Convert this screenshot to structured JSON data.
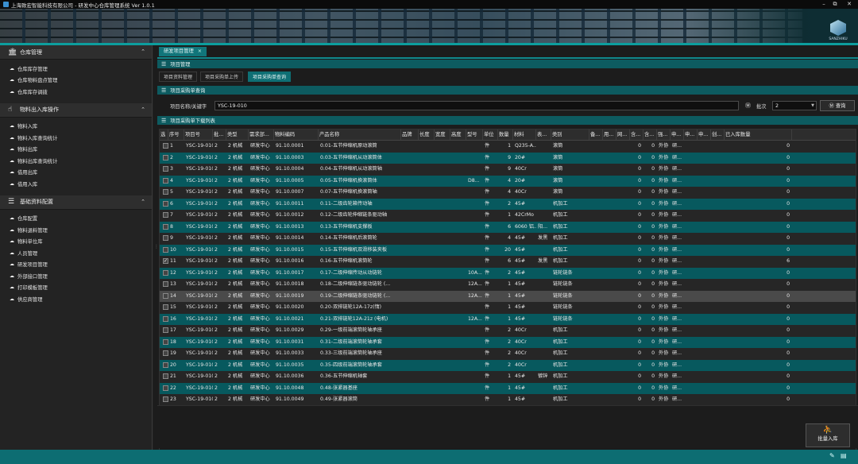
{
  "window": {
    "title": "上海致宏智能科技有限公司 - 研发中心仓库管理系统 Ver 1.0.1",
    "minimize": "–",
    "maximize": "⧉",
    "close": "✕"
  },
  "banner": {
    "logo_text": "SANZHIKU"
  },
  "sidebar": {
    "groups": [
      {
        "label": "仓库管理",
        "icon": "warehouse-icon",
        "items": [
          "仓库库存管理",
          "仓库物料盘点管理",
          "仓库库存调拨"
        ]
      },
      {
        "label": "物料出入库操作",
        "icon": "hand-pointer-icon",
        "items": [
          "物料入库",
          "物料入库查询统计",
          "物料出库",
          "物料出库查询统计",
          "借用出库",
          "借用入库"
        ]
      },
      {
        "label": "基础资料配置",
        "icon": "list-icon",
        "items": [
          "仓库配置",
          "物料退料管理",
          "物料单位库",
          "人员管理",
          "研发项目管理",
          "外部接口管理",
          "打印模板管理",
          "供应商管理"
        ]
      }
    ]
  },
  "main": {
    "top_tab": "研发项目管理",
    "section_project": "项目管理",
    "subtabs": [
      "项目资料管理",
      "项目采购单上传",
      "项目采购单查询"
    ],
    "active_subtab": 2,
    "section_query": "项目采购单查询",
    "query": {
      "label": "项目名称/关键字",
      "value": "YSC-19-010",
      "batch_label": "批次",
      "batch_value": "2",
      "button": "查询"
    },
    "section_detail": "项目采购单下载列表",
    "columns": [
      "选",
      "序号",
      "项目号",
      "批...",
      "类型",
      "需求部...",
      "物料编码",
      "产品名称",
      "品牌",
      "长度",
      "宽度",
      "高度",
      "型号",
      "单位",
      "数量",
      "材料",
      "表...",
      "类别",
      "备...",
      "用...",
      "网...",
      "含...",
      "含...",
      "强...",
      "申...",
      "申...",
      "申...",
      "创...",
      "已入库数量"
    ],
    "rows": [
      {
        "no": "1",
        "proj": "YSC-19-010",
        "batch": "2",
        "type": "2 机械",
        "dept": "研发中心",
        "code": "91.10.0001",
        "name": "0.01-五节伸缩机原动滚筒",
        "model": "",
        "unit": "件",
        "qty": "1",
        "mat": "Q235-A...",
        "surf": "",
        "cat": "滚筒",
        "c1": "0",
        "c2": "0",
        "sa": "外协",
        "sb": "研...",
        "stock": "0",
        "checked": false
      },
      {
        "no": "2",
        "proj": "YSC-19-010",
        "batch": "2",
        "type": "2 机械",
        "dept": "研发中心",
        "code": "91.10.0003",
        "name": "0.03-五节伸缩机从动滚筒体",
        "model": "",
        "unit": "件",
        "qty": "9",
        "mat": "20#",
        "surf": "",
        "cat": "滚筒",
        "c1": "0",
        "c2": "0",
        "sa": "外协",
        "sb": "研...",
        "stock": "0",
        "checked": false
      },
      {
        "no": "3",
        "proj": "YSC-19-010",
        "batch": "2",
        "type": "2 机械",
        "dept": "研发中心",
        "code": "91.10.0004",
        "name": "0.04-五节伸缩机从动滚筒轴",
        "model": "",
        "unit": "件",
        "qty": "9",
        "mat": "40Cr",
        "surf": "",
        "cat": "滚筒",
        "c1": "0",
        "c2": "0",
        "sa": "外协",
        "sb": "研...",
        "stock": "0",
        "checked": false
      },
      {
        "no": "4",
        "proj": "YSC-19-010",
        "batch": "2",
        "type": "2 机械",
        "dept": "研发中心",
        "code": "91.10.0005",
        "name": "0.05-五节伸缩机换滚筒体",
        "model": "D8...",
        "unit": "件",
        "qty": "4",
        "mat": "20#",
        "surf": "",
        "cat": "滚筒",
        "c1": "0",
        "c2": "0",
        "sa": "外协",
        "sb": "研...",
        "stock": "0",
        "checked": false
      },
      {
        "no": "5",
        "proj": "YSC-19-010",
        "batch": "2",
        "type": "2 机械",
        "dept": "研发中心",
        "code": "91.10.0007",
        "name": "0.07-五节伸缩机换滚筒轴",
        "model": "",
        "unit": "件",
        "qty": "4",
        "mat": "40Cr",
        "surf": "",
        "cat": "滚筒",
        "c1": "0",
        "c2": "0",
        "sa": "外协",
        "sb": "研...",
        "stock": "0",
        "checked": false
      },
      {
        "no": "6",
        "proj": "YSC-19-010",
        "batch": "2",
        "type": "2 机械",
        "dept": "研发中心",
        "code": "91.10.0011",
        "name": "0.11-二级齿轮箱传动轴",
        "model": "",
        "unit": "件",
        "qty": "2",
        "mat": "45#",
        "surf": "",
        "cat": "机加工",
        "c1": "0",
        "c2": "0",
        "sa": "外协",
        "sb": "研...",
        "stock": "0",
        "checked": false
      },
      {
        "no": "7",
        "proj": "YSC-19-010",
        "batch": "2",
        "type": "2 机械",
        "dept": "研发中心",
        "code": "91.10.0012",
        "name": "0.12-二级齿轮伸缩链条驱动轴",
        "model": "",
        "unit": "件",
        "qty": "1",
        "mat": "42CrMo",
        "surf": "",
        "cat": "机加工",
        "c1": "0",
        "c2": "0",
        "sa": "外协",
        "sb": "研...",
        "stock": "0",
        "checked": false
      },
      {
        "no": "8",
        "proj": "YSC-19-010",
        "batch": "2",
        "type": "2 机械",
        "dept": "研发中心",
        "code": "91.10.0013",
        "name": "0.13-五节伸缩机支撑板",
        "model": "",
        "unit": "件",
        "qty": "6",
        "mat": "6060 铝...",
        "surf": "阳...",
        "cat": "机加工",
        "c1": "0",
        "c2": "0",
        "sa": "外协",
        "sb": "研...",
        "stock": "0",
        "checked": false
      },
      {
        "no": "9",
        "proj": "YSC-19-010",
        "batch": "2",
        "type": "2 机械",
        "dept": "研发中心",
        "code": "91.10.0014",
        "name": "0.14-五节伸缩机后滚筒轮",
        "model": "",
        "unit": "件",
        "qty": "4",
        "mat": "45#",
        "surf": "发黑",
        "cat": "机加工",
        "c1": "0",
        "c2": "0",
        "sa": "外协",
        "sb": "研...",
        "stock": "0",
        "checked": false
      },
      {
        "no": "10",
        "proj": "YSC-19-010",
        "batch": "2",
        "type": "2 机械",
        "dept": "研发中心",
        "code": "91.10.0015",
        "name": "0.15-五节伸缩机双滑移装夹板",
        "model": "",
        "unit": "件",
        "qty": "20",
        "mat": "45#",
        "surf": "",
        "cat": "机加工",
        "c1": "0",
        "c2": "0",
        "sa": "外协",
        "sb": "研...",
        "stock": "0",
        "checked": false
      },
      {
        "no": "11",
        "proj": "YSC-19-010",
        "batch": "2",
        "type": "2 机械",
        "dept": "研发中心",
        "code": "91.10.0016",
        "name": "0.16-五节伸缩机滚筒轮",
        "model": "",
        "unit": "件",
        "qty": "6",
        "mat": "45#",
        "surf": "发黑",
        "cat": "机加工",
        "c1": "0",
        "c2": "0",
        "sa": "外协",
        "sb": "研...",
        "stock": "6",
        "checked": true
      },
      {
        "no": "12",
        "proj": "YSC-19-010",
        "batch": "2",
        "type": "2 机械",
        "dept": "研发中心",
        "code": "91.10.0017",
        "name": "0.17-二级伸缩传动从动链轮",
        "model": "10A...",
        "unit": "件",
        "qty": "2",
        "mat": "45#",
        "surf": "",
        "cat": "链轮链条",
        "c1": "0",
        "c2": "0",
        "sa": "外协",
        "sb": "研...",
        "stock": "0",
        "checked": false
      },
      {
        "no": "13",
        "proj": "YSC-19-010",
        "batch": "2",
        "type": "2 机械",
        "dept": "研发中心",
        "code": "91.10.0018",
        "name": "0.18-二级伸缩链条驱动链轮 (...",
        "model": "12A...",
        "unit": "件",
        "qty": "1",
        "mat": "45#",
        "surf": "",
        "cat": "链轮链条",
        "c1": "0",
        "c2": "0",
        "sa": "外协",
        "sb": "研...",
        "stock": "0",
        "checked": false
      },
      {
        "no": "14",
        "proj": "YSC-19-010",
        "batch": "2",
        "type": "2 机械",
        "dept": "研发中心",
        "code": "91.10.0019",
        "name": "0.19-二级伸缩链条驱动链轮 (...",
        "model": "12A...",
        "unit": "件",
        "qty": "1",
        "mat": "45#",
        "surf": "",
        "cat": "链轮链条",
        "c1": "0",
        "c2": "0",
        "sa": "外协",
        "sb": "研...",
        "stock": "0",
        "checked": false
      },
      {
        "no": "15",
        "proj": "YSC-19-010",
        "batch": "2",
        "type": "2 机械",
        "dept": "研发中心",
        "code": "91.10.0020",
        "name": "0.20-双排链轮12A-17z(惰)",
        "model": "",
        "unit": "件",
        "qty": "1",
        "mat": "45#",
        "surf": "",
        "cat": "链轮链条",
        "c1": "0",
        "c2": "0",
        "sa": "外协",
        "sb": "研...",
        "stock": "0",
        "checked": false
      },
      {
        "no": "16",
        "proj": "YSC-19-010",
        "batch": "2",
        "type": "2 机械",
        "dept": "研发中心",
        "code": "91.10.0021",
        "name": "0.21-双排链轮12A-21z (电机)",
        "model": "12A...",
        "unit": "件",
        "qty": "1",
        "mat": "45#",
        "surf": "",
        "cat": "链轮链条",
        "c1": "0",
        "c2": "0",
        "sa": "外协",
        "sb": "研...",
        "stock": "0",
        "checked": false
      },
      {
        "no": "17",
        "proj": "YSC-19-010",
        "batch": "2",
        "type": "2 机械",
        "dept": "研发中心",
        "code": "91.10.0029",
        "name": "0.29-一级前端滚筒轮轴承座",
        "model": "",
        "unit": "件",
        "qty": "2",
        "mat": "40Cr",
        "surf": "",
        "cat": "机加工",
        "c1": "0",
        "c2": "0",
        "sa": "外协",
        "sb": "研...",
        "stock": "0",
        "checked": false
      },
      {
        "no": "18",
        "proj": "YSC-19-010",
        "batch": "2",
        "type": "2 机械",
        "dept": "研发中心",
        "code": "91.10.0031",
        "name": "0.31-二级前端滚筒轮轴承套",
        "model": "",
        "unit": "件",
        "qty": "2",
        "mat": "40Cr",
        "surf": "",
        "cat": "机加工",
        "c1": "0",
        "c2": "0",
        "sa": "外协",
        "sb": "研...",
        "stock": "0",
        "checked": false
      },
      {
        "no": "19",
        "proj": "YSC-19-010",
        "batch": "2",
        "type": "2 机械",
        "dept": "研发中心",
        "code": "91.10.0033",
        "name": "0.33-三级前端滚筒轮轴承座",
        "model": "",
        "unit": "件",
        "qty": "2",
        "mat": "40Cr",
        "surf": "",
        "cat": "机加工",
        "c1": "0",
        "c2": "0",
        "sa": "外协",
        "sb": "研...",
        "stock": "0",
        "checked": false
      },
      {
        "no": "20",
        "proj": "YSC-19-010",
        "batch": "2",
        "type": "2 机械",
        "dept": "研发中心",
        "code": "91.10.0035",
        "name": "0.35-四级前端滚筒轮轴承套",
        "model": "",
        "unit": "件",
        "qty": "2",
        "mat": "40Cr",
        "surf": "",
        "cat": "机加工",
        "c1": "0",
        "c2": "0",
        "sa": "外协",
        "sb": "研...",
        "stock": "0",
        "checked": false
      },
      {
        "no": "21",
        "proj": "YSC-19-010",
        "batch": "2",
        "type": "2 机械",
        "dept": "研发中心",
        "code": "91.10.0036",
        "name": "0.36-五节伸缩机轴套",
        "model": "",
        "unit": "件",
        "qty": "1",
        "mat": "45#",
        "surf": "镀锌",
        "cat": "机加工",
        "c1": "0",
        "c2": "0",
        "sa": "外协",
        "sb": "研...",
        "stock": "0",
        "checked": false
      },
      {
        "no": "22",
        "proj": "YSC-19-010",
        "batch": "2",
        "type": "2 机械",
        "dept": "研发中心",
        "code": "91.10.0048",
        "name": "0.48-张紧器基座",
        "model": "",
        "unit": "件",
        "qty": "1",
        "mat": "45#",
        "surf": "",
        "cat": "机加工",
        "c1": "0",
        "c2": "0",
        "sa": "外协",
        "sb": "研...",
        "stock": "0",
        "checked": false
      },
      {
        "no": "23",
        "proj": "YSC-19-010",
        "batch": "2",
        "type": "2 机械",
        "dept": "研发中心",
        "code": "91.10.0049",
        "name": "0.49-张紧器滚筒",
        "model": "",
        "unit": "件",
        "qty": "1",
        "mat": "45#",
        "surf": "",
        "cat": "机加工",
        "c1": "0",
        "c2": "0",
        "sa": "外协",
        "sb": "研...",
        "stock": "0",
        "checked": false
      }
    ],
    "current_row": 14,
    "batch_button": "批量入库"
  },
  "colors": {
    "teal": "#0d9e9e",
    "row_teal": "#07595e",
    "header": "#0d5b60"
  }
}
